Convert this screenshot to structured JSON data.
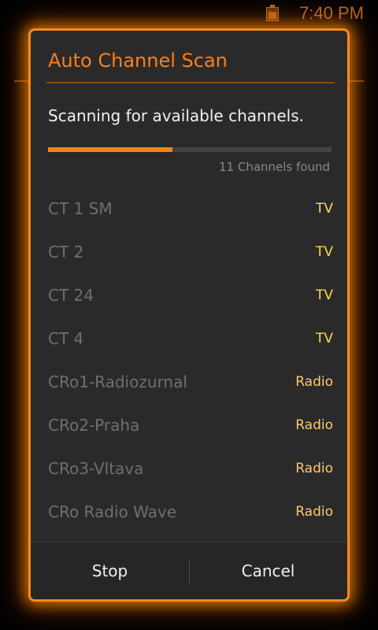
{
  "status_bar": {
    "time": "7:40 PM",
    "battery_icon": "battery-icon",
    "color": "#b3661a"
  },
  "dialog": {
    "title": "Auto Channel Scan",
    "message": "Scanning for available channels.",
    "progress_fraction": 0.44,
    "found_text": "11 Channels found",
    "accent_color": "#ff7f1a",
    "channels": [
      {
        "name": "CT 1 SM",
        "type": "TV"
      },
      {
        "name": "CT 2",
        "type": "TV"
      },
      {
        "name": "CT 24",
        "type": "TV"
      },
      {
        "name": "CT 4",
        "type": "TV"
      },
      {
        "name": "CRo1-Radiozurnal",
        "type": "Radio"
      },
      {
        "name": "CRo2-Praha",
        "type": "Radio"
      },
      {
        "name": "CRo3-Vltava",
        "type": "Radio"
      },
      {
        "name": "CRo Radio Wave",
        "type": "Radio"
      }
    ],
    "buttons": {
      "stop_label": "Stop",
      "cancel_label": "Cancel"
    }
  }
}
